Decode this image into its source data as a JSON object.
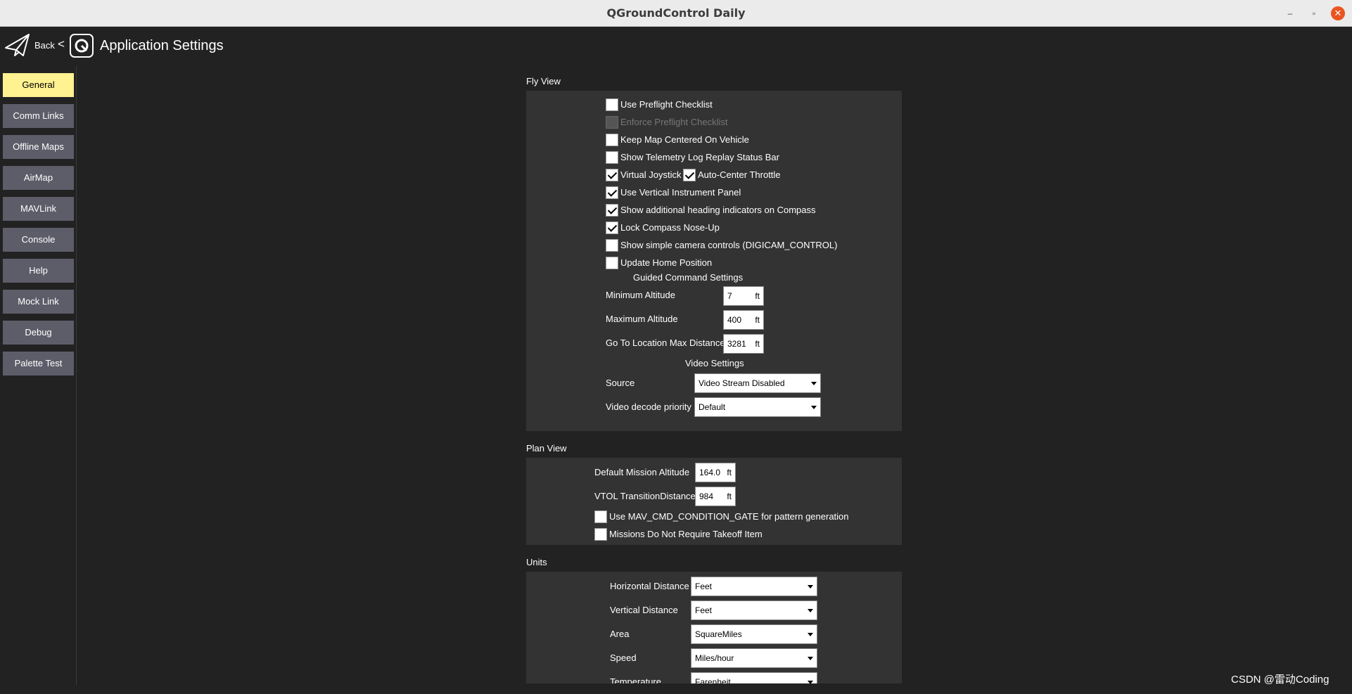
{
  "window": {
    "title": "QGroundControl Daily",
    "minimize": "–",
    "maximize": "▫",
    "close": "✕"
  },
  "header": {
    "back_label": "Back",
    "chevron": "<",
    "page_title": "Application Settings"
  },
  "sidebar": {
    "items": [
      {
        "label": "General",
        "active": true
      },
      {
        "label": "Comm Links",
        "active": false
      },
      {
        "label": "Offline Maps",
        "active": false
      },
      {
        "label": "AirMap",
        "active": false
      },
      {
        "label": "MAVLink",
        "active": false
      },
      {
        "label": "Console",
        "active": false
      },
      {
        "label": "Help",
        "active": false
      },
      {
        "label": "Mock Link",
        "active": false
      },
      {
        "label": "Debug",
        "active": false
      },
      {
        "label": "Palette Test",
        "active": false
      }
    ]
  },
  "fly_view": {
    "header": "Fly View",
    "checkboxes": [
      {
        "label": "Use Preflight Checklist",
        "checked": false,
        "disabled": false
      },
      {
        "label": "Enforce Preflight Checklist",
        "checked": false,
        "disabled": true
      },
      {
        "label": "Keep Map Centered On Vehicle",
        "checked": false,
        "disabled": false
      },
      {
        "label": "Show Telemetry Log Replay Status Bar",
        "checked": false,
        "disabled": false
      },
      {
        "label": "Virtual Joystick",
        "checked": true,
        "disabled": false
      },
      {
        "label": "Auto-Center Throttle",
        "checked": true,
        "disabled": false
      },
      {
        "label": "Use Vertical Instrument Panel",
        "checked": true,
        "disabled": false
      },
      {
        "label": "Show additional heading indicators on Compass",
        "checked": true,
        "disabled": false
      },
      {
        "label": "Lock Compass Nose-Up",
        "checked": true,
        "disabled": false
      },
      {
        "label": "Show simple camera controls (DIGICAM_CONTROL)",
        "checked": false,
        "disabled": false
      },
      {
        "label": "Update Home Position",
        "checked": false,
        "disabled": false
      }
    ],
    "guided": {
      "header": "Guided Command Settings",
      "fields": [
        {
          "label": "Minimum Altitude",
          "value": "7",
          "unit": "ft"
        },
        {
          "label": "Maximum Altitude",
          "value": "400",
          "unit": "ft"
        },
        {
          "label": "Go To Location Max Distance",
          "value": "3281",
          "unit": "ft"
        }
      ]
    },
    "video": {
      "header": "Video Settings",
      "fields": [
        {
          "label": "Source",
          "value": "Video Stream Disabled"
        },
        {
          "label": "Video decode priority",
          "value": "Default"
        }
      ]
    }
  },
  "plan_view": {
    "header": "Plan View",
    "fields": [
      {
        "label": "Default Mission Altitude",
        "value": "164.0",
        "unit": "ft"
      },
      {
        "label": "VTOL TransitionDistance",
        "value": "984",
        "unit": "ft"
      }
    ],
    "checkboxes": [
      {
        "label": "Use MAV_CMD_CONDITION_GATE for pattern generation",
        "checked": false
      },
      {
        "label": "Missions Do Not Require Takeoff Item",
        "checked": false
      }
    ]
  },
  "units": {
    "header": "Units",
    "fields": [
      {
        "label": "Horizontal Distance",
        "value": "Feet"
      },
      {
        "label": "Vertical Distance",
        "value": "Feet"
      },
      {
        "label": "Area",
        "value": "SquareMiles"
      },
      {
        "label": "Speed",
        "value": "Miles/hour"
      },
      {
        "label": "Temperature",
        "value": "Farenheit"
      }
    ]
  },
  "watermark": "CSDN @雷动Coding"
}
